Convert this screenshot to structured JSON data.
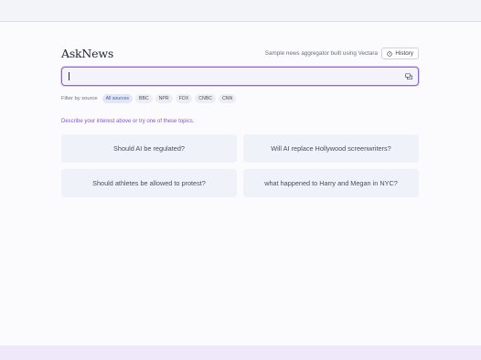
{
  "header": {
    "logo": "AskNews",
    "tagline": "Sample news aggregator built using Vectara",
    "history_label": "History"
  },
  "search": {
    "value": "",
    "placeholder": ""
  },
  "filters": {
    "label": "Filter by source",
    "sources": [
      "All sources",
      "BBC",
      "NPR",
      "FOX",
      "CNBC",
      "CNN"
    ],
    "selected": "All sources"
  },
  "hint": "Describe your interest above or try one of these topics.",
  "topics": [
    "Should AI be regulated?",
    "Will AI replace Hollywood screenwriters?",
    "Should athletes be allowed to protest?",
    "what happened to Harry and Megan in NYC?"
  ],
  "icons": {
    "history": "clock-icon",
    "search_submit": "chat-icon"
  },
  "colors": {
    "accent": "#8e6bb8",
    "hint": "#8a55c4",
    "card_bg": "#eff2f9",
    "active_chip": "#3f5fa6"
  }
}
